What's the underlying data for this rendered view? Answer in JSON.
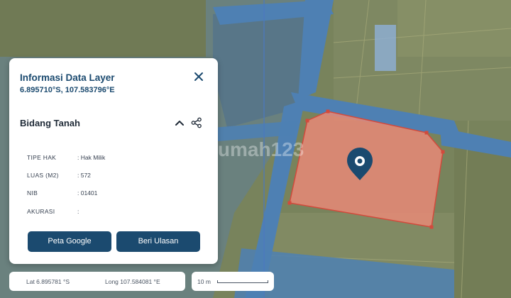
{
  "map": {
    "watermark": "rumah123",
    "colors": {
      "field": "#7b8560",
      "road": "#4f7fb0",
      "parcel_fill": "#e88a77",
      "parcel_stroke": "#d24a3c",
      "marker": "#1b4a6f"
    },
    "marker_icon": "map-pin-icon"
  },
  "info_panel": {
    "title": "Informasi Data Layer",
    "coordinates": "6.895710°S, 107.583796°E",
    "close_icon": "close-icon",
    "section_title": "Bidang Tanah",
    "collapse_icon": "chevron-up-icon",
    "share_icon": "share-icon",
    "attributes": [
      {
        "key": "TIPE HAK",
        "value": ": Hak Milik"
      },
      {
        "key": "LUAS (M2)",
        "value": ": 572"
      },
      {
        "key": "NIB",
        "value": ": 01401"
      },
      {
        "key": "AKURASI",
        "value": ":"
      }
    ],
    "buttons": {
      "google_map": "Peta Google",
      "review": "Beri Ulasan"
    }
  },
  "coord_bar": {
    "lat": "Lat 6.895781 °S",
    "lng": "Long 107.584081 °E"
  },
  "scale": {
    "label": "10 m"
  }
}
